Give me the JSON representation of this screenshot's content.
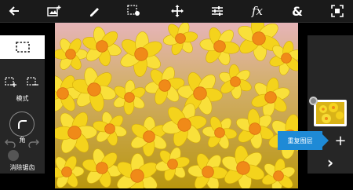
{
  "toolbar": {
    "icons": [
      "back-arrow-icon",
      "add-image-icon",
      "brush-icon",
      "select-settings-icon",
      "move-icon",
      "adjustments-icon",
      "fx-icon",
      "blend-icon",
      "fit-screen-icon"
    ],
    "fx_label": "fx",
    "blend_label": "&"
  },
  "left_panel": {
    "mode_label": "模式",
    "corner_label": "角",
    "clear_label": "消除锯齿"
  },
  "right_panel": {
    "tooltip_label": "重复图层",
    "add_label": "+",
    "next_label": "›"
  },
  "colors": {
    "toolbar_bg": "#1a1a1a",
    "panel_bg": "#262626",
    "accent": "#1e8ad6",
    "flower_yellow": "#f2d21b",
    "flower_orange": "#f08a18"
  }
}
